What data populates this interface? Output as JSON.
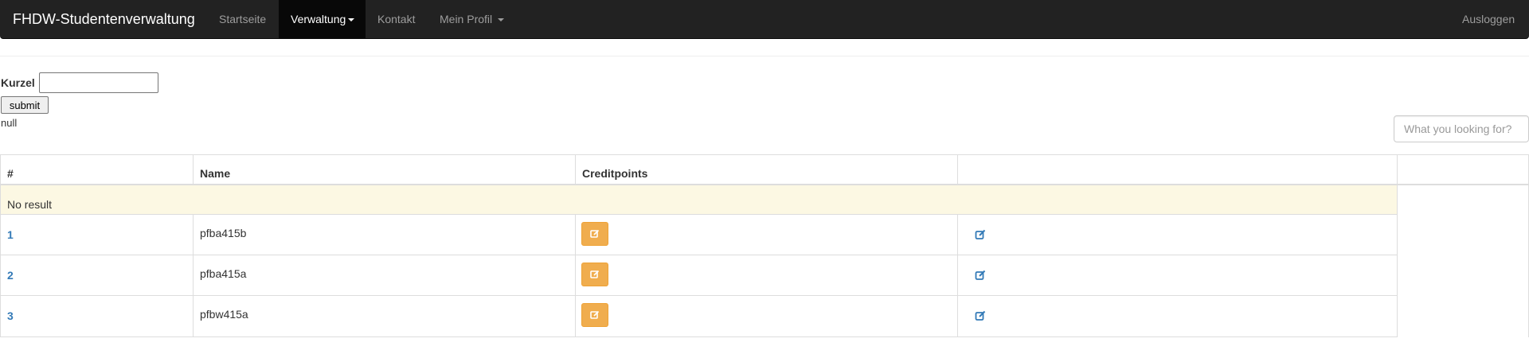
{
  "navbar": {
    "brand": "FHDW-Studentenverwaltung",
    "items": [
      {
        "label": "Startseite"
      },
      {
        "label": "Verwaltung"
      },
      {
        "label": "Kontakt"
      },
      {
        "label": "Mein Profil"
      }
    ],
    "logout": "Ausloggen"
  },
  "form": {
    "kurzel_label": "Kurzel",
    "kurzel_value": "",
    "submit_label": "submit",
    "result_text": "null"
  },
  "search": {
    "placeholder": "What you looking for?"
  },
  "table": {
    "headers": [
      "#",
      "Name",
      "Creditpoints",
      "",
      ""
    ],
    "empty_message": "No result",
    "rows": [
      {
        "id": "1",
        "name": "pfba415b"
      },
      {
        "id": "2",
        "name": "pfba415a"
      },
      {
        "id": "3",
        "name": "pfbw415a"
      }
    ]
  },
  "icons": {
    "creditpoints_button": "edit-icon",
    "edit_link": "edit-icon"
  },
  "colors": {
    "navbar_bg": "#222222",
    "navbar_active_bg": "#080808",
    "warning_row_bg": "#fcf8e3",
    "button_warning": "#f0ad4e",
    "link_blue": "#337ab7"
  }
}
